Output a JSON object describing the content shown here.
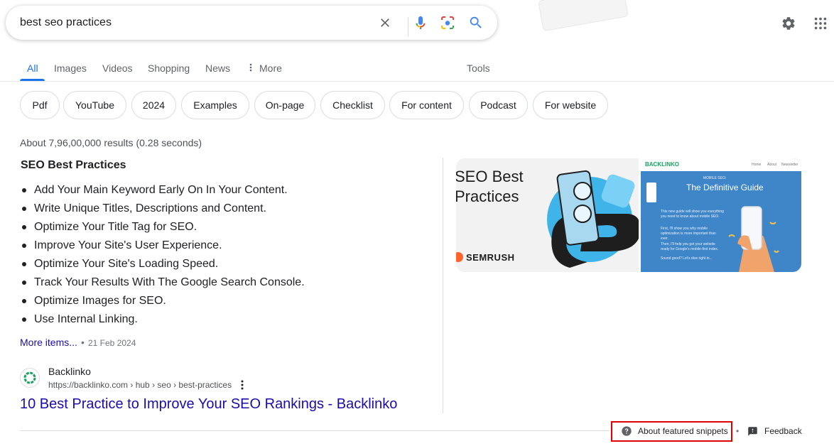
{
  "search": {
    "query": "best seo practices",
    "clear_icon": "close-icon",
    "voice_icon": "microphone-icon",
    "lens_icon": "camera-lens-icon",
    "search_icon": "search-icon"
  },
  "header": {
    "settings_icon": "gear-icon",
    "apps_icon": "grid-apps-icon"
  },
  "tabs": [
    {
      "label": "All",
      "active": true
    },
    {
      "label": "Images"
    },
    {
      "label": "Videos"
    },
    {
      "label": "Shopping"
    },
    {
      "label": "News"
    },
    {
      "label": "More",
      "icon": "more-vertical-icon"
    }
  ],
  "tools_label": "Tools",
  "chips": [
    "Pdf",
    "YouTube",
    "2024",
    "Examples",
    "On-page",
    "Checklist",
    "For content",
    "Podcast",
    "For website"
  ],
  "result_stats": "About 7,96,00,000 results (0.28 seconds)",
  "featured_snippet": {
    "heading": "SEO Best Practices",
    "items": [
      "Add Your Main Keyword Early On In Your Content.",
      "Write Unique Titles, Descriptions and Content.",
      "Optimize Your Title Tag for SEO.",
      "Improve Your Site's User Experience.",
      "Optimize Your Site's Loading Speed.",
      "Track Your Results With The Google Search Console.",
      "Optimize Images for SEO.",
      "Use Internal Linking."
    ],
    "more_items": "More items...",
    "separator": "•",
    "date": "21 Feb 2024",
    "source": {
      "name": "Backlinko",
      "url": "https://backlinko.com › hub › seo › best-practices",
      "title": "10 Best Practice to Improve Your SEO Rankings - Backlinko"
    },
    "images": [
      {
        "title": "SEO Best\nPractices",
        "brand": "SEMRUSH"
      },
      {
        "logo": "BACKLINKO",
        "nav": [
          "Home",
          "About",
          "Newsletter"
        ],
        "kicker": "MOBILE SEO:",
        "title": "The Definitive Guide",
        "body": [
          "This new guide will show you everything you need to know about mobile SEO.",
          "First, I'll show you why mobile optimization is more important than ever.",
          "Then, I'll help you get your website ready for Google's mobile-first index.",
          "Sound good? Let's dive right in..."
        ]
      }
    ]
  },
  "footer": {
    "about_label": "About featured snippets",
    "about_icon": "help-circle-icon",
    "separator": "•",
    "feedback_label": "Feedback",
    "feedback_icon": "feedback-icon"
  },
  "colors": {
    "link": "#1a0dab",
    "accent": "#1a73e8",
    "highlight_box": "#e00000"
  }
}
